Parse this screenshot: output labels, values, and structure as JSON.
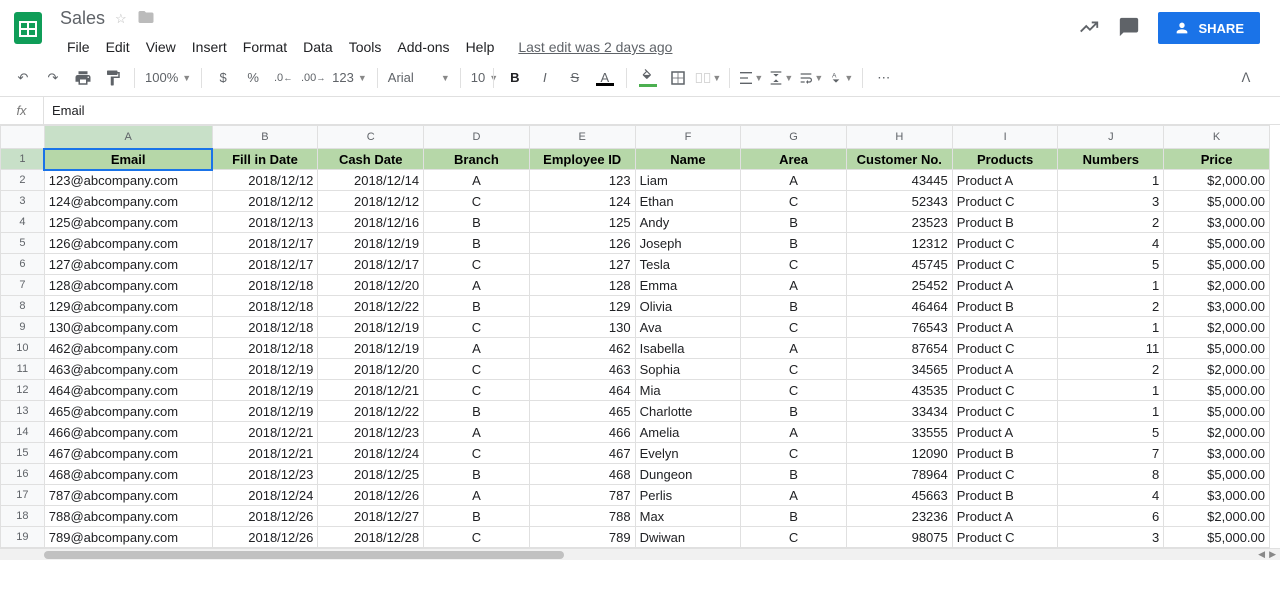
{
  "header": {
    "title": "Sales",
    "menus": [
      "File",
      "Edit",
      "View",
      "Insert",
      "Format",
      "Data",
      "Tools",
      "Add-ons",
      "Help"
    ],
    "last_edit": "Last edit was 2 days ago",
    "share_label": "SHARE"
  },
  "toolbar": {
    "zoom": "100%",
    "font": "Arial",
    "font_size": "10",
    "format_hint": "123"
  },
  "formula_bar": {
    "fx": "fx",
    "value": "Email"
  },
  "columns": [
    "A",
    "B",
    "C",
    "D",
    "E",
    "F",
    "G",
    "H",
    "I",
    "J",
    "K"
  ],
  "headers": [
    "Email",
    "Fill in Date",
    "Cash Date",
    "Branch",
    "Employee ID",
    "Name",
    "Area",
    "Customer No.",
    "Products",
    "Numbers",
    "Price"
  ],
  "row_numbers": [
    1,
    2,
    3,
    4,
    5,
    6,
    7,
    8,
    9,
    10,
    11,
    12,
    13,
    14,
    15,
    16,
    17,
    18,
    19
  ],
  "rows": [
    {
      "email": "123@abcompany.com",
      "fill": "2018/12/12",
      "cash": "2018/12/14",
      "branch": "A",
      "empid": "123",
      "name": "Liam",
      "area": "A",
      "cust": "43445",
      "prod": "Product A",
      "num": "1",
      "price": "$2,000.00"
    },
    {
      "email": "124@abcompany.com",
      "fill": "2018/12/12",
      "cash": "2018/12/12",
      "branch": "C",
      "empid": "124",
      "name": "Ethan",
      "area": "C",
      "cust": "52343",
      "prod": "Product C",
      "num": "3",
      "price": "$5,000.00"
    },
    {
      "email": "125@abcompany.com",
      "fill": "2018/12/13",
      "cash": "2018/12/16",
      "branch": "B",
      "empid": "125",
      "name": "Andy",
      "area": "B",
      "cust": "23523",
      "prod": "Product B",
      "num": "2",
      "price": "$3,000.00"
    },
    {
      "email": "126@abcompany.com",
      "fill": "2018/12/17",
      "cash": "2018/12/19",
      "branch": "B",
      "empid": "126",
      "name": "Joseph",
      "area": "B",
      "cust": "12312",
      "prod": "Product C",
      "num": "4",
      "price": "$5,000.00"
    },
    {
      "email": "127@abcompany.com",
      "fill": "2018/12/17",
      "cash": "2018/12/17",
      "branch": "C",
      "empid": "127",
      "name": "Tesla",
      "area": "C",
      "cust": "45745",
      "prod": "Product C",
      "num": "5",
      "price": "$5,000.00"
    },
    {
      "email": "128@abcompany.com",
      "fill": "2018/12/18",
      "cash": "2018/12/20",
      "branch": "A",
      "empid": "128",
      "name": "Emma",
      "area": "A",
      "cust": "25452",
      "prod": "Product A",
      "num": "1",
      "price": "$2,000.00"
    },
    {
      "email": "129@abcompany.com",
      "fill": "2018/12/18",
      "cash": "2018/12/22",
      "branch": "B",
      "empid": "129",
      "name": "Olivia",
      "area": "B",
      "cust": "46464",
      "prod": "Product B",
      "num": "2",
      "price": "$3,000.00"
    },
    {
      "email": "130@abcompany.com",
      "fill": "2018/12/18",
      "cash": "2018/12/19",
      "branch": "C",
      "empid": "130",
      "name": "Ava",
      "area": "C",
      "cust": "76543",
      "prod": "Product A",
      "num": "1",
      "price": "$2,000.00"
    },
    {
      "email": "462@abcompany.com",
      "fill": "2018/12/18",
      "cash": "2018/12/19",
      "branch": "A",
      "empid": "462",
      "name": "Isabella",
      "area": "A",
      "cust": "87654",
      "prod": "Product C",
      "num": "11",
      "price": "$5,000.00"
    },
    {
      "email": "463@abcompany.com",
      "fill": "2018/12/19",
      "cash": "2018/12/20",
      "branch": "C",
      "empid": "463",
      "name": "Sophia",
      "area": "C",
      "cust": "34565",
      "prod": "Product A",
      "num": "2",
      "price": "$2,000.00"
    },
    {
      "email": "464@abcompany.com",
      "fill": "2018/12/19",
      "cash": "2018/12/21",
      "branch": "C",
      "empid": "464",
      "name": "Mia",
      "area": "C",
      "cust": "43535",
      "prod": "Product C",
      "num": "1",
      "price": "$5,000.00"
    },
    {
      "email": "465@abcompany.com",
      "fill": "2018/12/19",
      "cash": "2018/12/22",
      "branch": "B",
      "empid": "465",
      "name": "Charlotte",
      "area": "B",
      "cust": "33434",
      "prod": "Product C",
      "num": "1",
      "price": "$5,000.00"
    },
    {
      "email": "466@abcompany.com",
      "fill": "2018/12/21",
      "cash": "2018/12/23",
      "branch": "A",
      "empid": "466",
      "name": "Amelia",
      "area": "A",
      "cust": "33555",
      "prod": "Product A",
      "num": "5",
      "price": "$2,000.00"
    },
    {
      "email": "467@abcompany.com",
      "fill": "2018/12/21",
      "cash": "2018/12/24",
      "branch": "C",
      "empid": "467",
      "name": "Evelyn",
      "area": "C",
      "cust": "12090",
      "prod": "Product B",
      "num": "7",
      "price": "$3,000.00"
    },
    {
      "email": "468@abcompany.com",
      "fill": "2018/12/23",
      "cash": "2018/12/25",
      "branch": "B",
      "empid": "468",
      "name": "Dungeon",
      "area": "B",
      "cust": "78964",
      "prod": "Product C",
      "num": "8",
      "price": "$5,000.00"
    },
    {
      "email": "787@abcompany.com",
      "fill": "2018/12/24",
      "cash": "2018/12/26",
      "branch": "A",
      "empid": "787",
      "name": "Perlis",
      "area": "A",
      "cust": "45663",
      "prod": "Product B",
      "num": "4",
      "price": "$3,000.00"
    },
    {
      "email": "788@abcompany.com",
      "fill": "2018/12/26",
      "cash": "2018/12/27",
      "branch": "B",
      "empid": "788",
      "name": "Max",
      "area": "B",
      "cust": "23236",
      "prod": "Product A",
      "num": "6",
      "price": "$2,000.00"
    },
    {
      "email": "789@abcompany.com",
      "fill": "2018/12/26",
      "cash": "2018/12/28",
      "branch": "C",
      "empid": "789",
      "name": "Dwiwan",
      "area": "C",
      "cust": "98075",
      "prod": "Product C",
      "num": "3",
      "price": "$5,000.00"
    }
  ]
}
